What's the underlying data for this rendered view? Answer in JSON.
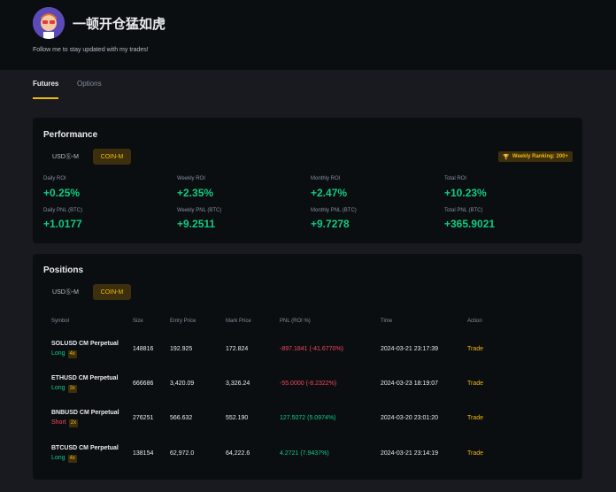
{
  "profile": {
    "username": "一顿开仓猛如虎",
    "bio": "Follow me to stay updated with my trades!"
  },
  "tabs": [
    {
      "label": "Futures",
      "active": true
    },
    {
      "label": "Options",
      "active": false
    }
  ],
  "performance": {
    "title": "Performance",
    "toggle": [
      "USDⓈ-M",
      "COIN-M"
    ],
    "selected": "COIN-M",
    "ranking_badge": "Weekly Ranking: 200+",
    "stats": [
      {
        "label": "Daily ROI",
        "value": "+0.25%"
      },
      {
        "label": "Weekly ROI",
        "value": "+2.35%"
      },
      {
        "label": "Monthly ROI",
        "value": "+2.47%"
      },
      {
        "label": "Total ROI",
        "value": "+10.23%"
      },
      {
        "label": "Daily PNL (BTC)",
        "value": "+1.0177"
      },
      {
        "label": "Weekly PNL (BTC)",
        "value": "+9.2511"
      },
      {
        "label": "Monthly PNL (BTC)",
        "value": "+9.7278"
      },
      {
        "label": "Total PNL (BTC)",
        "value": "+365.9021"
      }
    ]
  },
  "positions": {
    "title": "Positions",
    "toggle": [
      "USDⓈ-M",
      "COIN-M"
    ],
    "selected": "COIN-M",
    "headers": [
      "Symbol",
      "Size",
      "Entry Price",
      "Mark Price",
      "PNL (ROI %)",
      "Time",
      "Action"
    ],
    "rows": [
      {
        "symbol": "SOLUSD CM Perpetual",
        "side": "Long",
        "leverage": "4x",
        "size": "148816",
        "entry": "192.925",
        "mark": "172.824",
        "pnl": "-897.1841 (-41.6770%)",
        "pnl_sign": "neg",
        "time": "2024-03-21 23:17:39",
        "action": "Trade"
      },
      {
        "symbol": "ETHUSD CM Perpetual",
        "side": "Long",
        "leverage": "3x",
        "size": "666686",
        "entry": "3,420.09",
        "mark": "3,326.24",
        "pnl": "-55.0000 (-8.2322%)",
        "pnl_sign": "neg",
        "time": "2024-03-23 18:19:07",
        "action": "Trade"
      },
      {
        "symbol": "BNBUSD CM Perpetual",
        "side": "Short",
        "leverage": "2x",
        "size": "276251",
        "entry": "566.632",
        "mark": "552.190",
        "pnl": "127.5072 (5.0974%)",
        "pnl_sign": "pos",
        "time": "2024-03-20 23:01:20",
        "action": "Trade"
      },
      {
        "symbol": "BTCUSD CM Perpetual",
        "side": "Long",
        "leverage": "4x",
        "size": "138154",
        "entry": "62,972.0",
        "mark": "64,222.6",
        "pnl": "4.2721 (7.9437%)",
        "pnl_sign": "pos",
        "time": "2024-03-21 23:14:19",
        "action": "Trade"
      }
    ]
  },
  "colors": {
    "accent": "#f0b90b",
    "positive": "#0ecb81",
    "negative": "#f6465d",
    "background": "#181a20",
    "card": "#0b0e11"
  }
}
